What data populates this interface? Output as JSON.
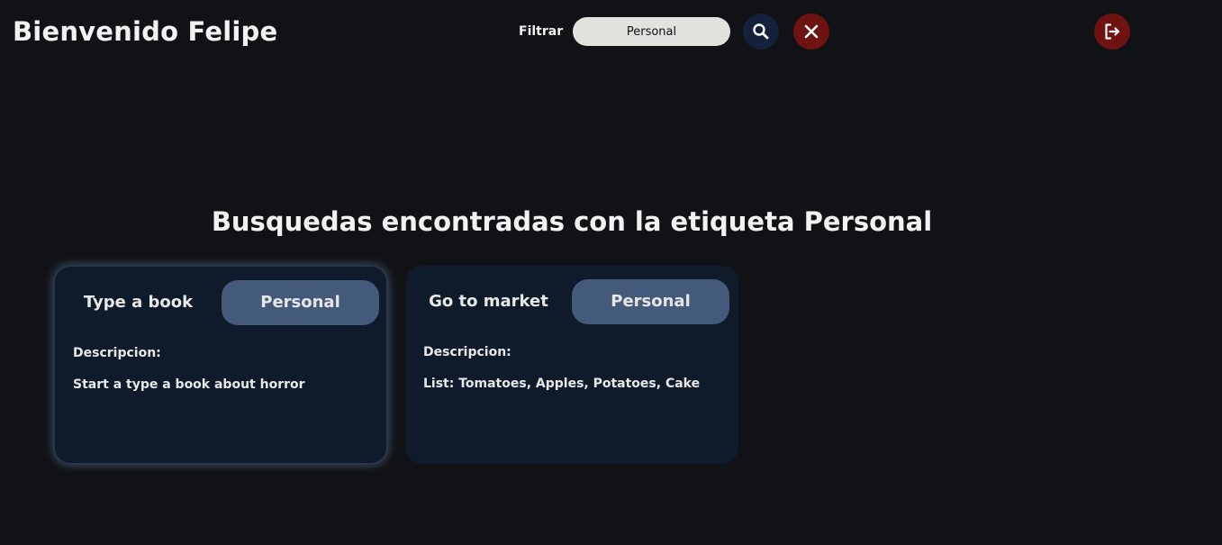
{
  "header": {
    "welcome": "Bienvenido Felipe",
    "filter_label": "Filtrar",
    "filter_value": "Personal",
    "search_icon": "search-icon",
    "clear_icon": "close-icon",
    "logout_icon": "logout-icon"
  },
  "results": {
    "title": "Busquedas encontradas con la etiqueta Personal",
    "cards": [
      {
        "title": "Type a book",
        "tag": "Personal",
        "description_label": "Descripcion:",
        "description": "Start a type a book about horror"
      },
      {
        "title": "Go to market",
        "tag": "Personal",
        "description_label": "Descripcion:",
        "description": "List: Tomatoes, Apples, Potatoes, Cake"
      }
    ]
  },
  "colors": {
    "background": "#101216",
    "card": "#0f1a2b",
    "tag": "#435a7a",
    "danger": "#6e1212",
    "search_button": "#14213a",
    "input": "#e2e2df"
  }
}
